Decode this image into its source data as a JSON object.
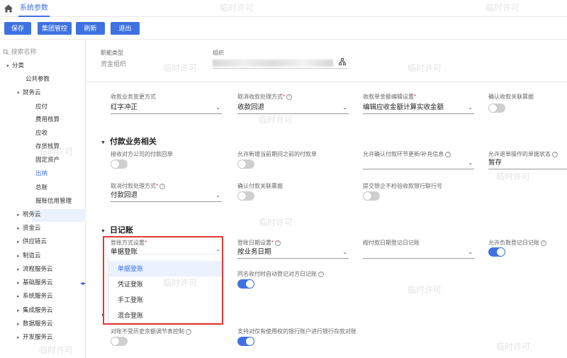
{
  "header": {
    "tab": "系统参数"
  },
  "toolbar": {
    "buttons": [
      "保存",
      "集团管控",
      "刷新",
      "退出"
    ]
  },
  "sidebar": {
    "search_placeholder": "搜索名称",
    "items": [
      "分类",
      "公共参数",
      "财务云",
      "应付",
      "费用核算",
      "应收",
      "存货核算",
      "固定资产",
      "出纳",
      "总账",
      "报账信用管理",
      "税务云",
      "资金云",
      "供应链云",
      "制造云",
      "流程服务云",
      "基础服务云",
      "系统服务云",
      "集成服务云",
      "数据服务云",
      "开发服务云"
    ],
    "selected": "出纳"
  },
  "org": {
    "role_type_label": "职能类型",
    "role_type_value": "资金组织",
    "org_label": "组织"
  },
  "receipt": {
    "f1_label": "收款业务变更方式",
    "f1_value": "红字冲正",
    "f2_label": "取消收款处理方式",
    "f2_value": "收款回退",
    "f3_label": "收款单金额编辑设置",
    "f3_value": "编辑应收金额计算实收金额",
    "f4_label": "确认收款关联票据"
  },
  "payment": {
    "title": "付款业务相关",
    "p1_label": "接收对方公司的付款回单",
    "p2_label": "允许新增当前期间之前的付款单",
    "p3_label": "允许确认付款环节更新/补充信息",
    "p4_label": "允许退单操作的单据状态",
    "p4_value": "暂存",
    "p5_label": "取消付款处理方式",
    "p5_value": "付款回退",
    "p6_label": "确认付款关联票据",
    "p7_label": "提交银企不检验收款银行联行号"
  },
  "journal": {
    "title": "日记账",
    "j1_label": "登账方式设置",
    "j1_value": "单据登账",
    "j2_label": "登账日期设置",
    "j2_value": "按业务日期",
    "j3_label": "按付款日期登记日记账",
    "j4_label": "允许负数登记日记账",
    "j5_label": "同名收付时自动登记对方日记账",
    "options": [
      "单据登账",
      "凭证登账",
      "手工登账",
      "混合登账"
    ]
  },
  "bottom": {
    "b1_label": "对账不受历史余额调节表控制",
    "b2_label": "支持对仅有使用权的银行账户进行银行存款对账"
  },
  "watermark": "临时许可",
  "colors": {
    "accent": "#3f72e0",
    "highlight": "#e53935"
  }
}
